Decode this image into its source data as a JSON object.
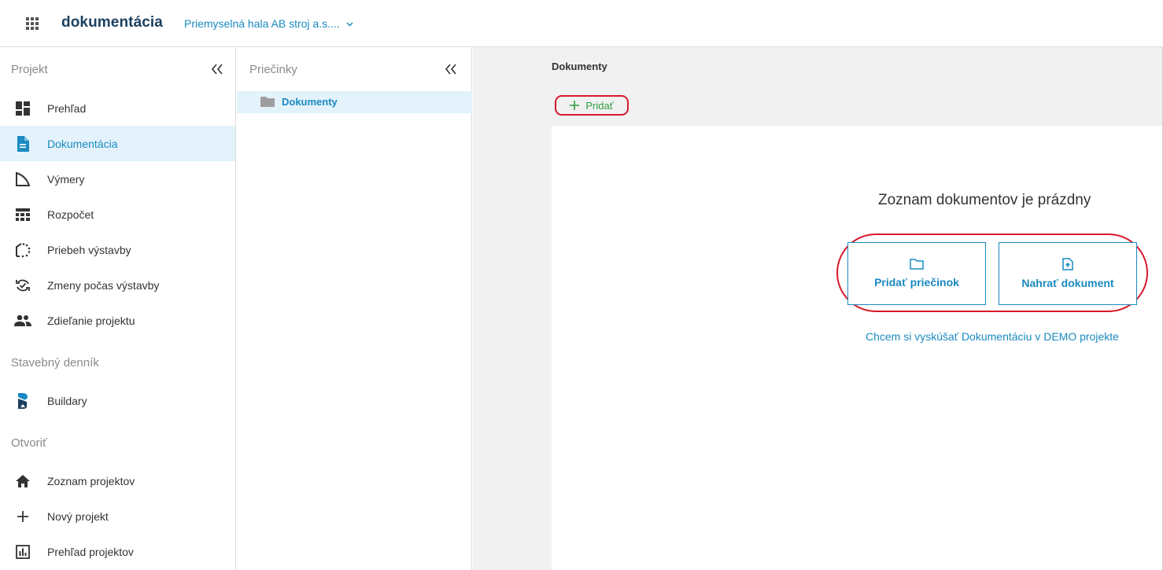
{
  "app": {
    "title": "dokumentácia",
    "project_name": "Priemyselná hala AB stroj a.s...."
  },
  "sidebar": {
    "section_project": "Projekt",
    "section_diary": "Stavebný denník",
    "section_open": "Otvoriť",
    "items": [
      {
        "label": "Prehľad",
        "icon": "dashboard-icon",
        "active": false
      },
      {
        "label": "Dokumentácia",
        "icon": "document-icon",
        "active": true
      },
      {
        "label": "Výmery",
        "icon": "measure-icon",
        "active": false
      },
      {
        "label": "Rozpočet",
        "icon": "budget-icon",
        "active": false
      },
      {
        "label": "Priebeh výstavby",
        "icon": "progress-icon",
        "active": false
      },
      {
        "label": "Zmeny počas výstavby",
        "icon": "changes-icon",
        "active": false
      },
      {
        "label": "Zdieľanie projektu",
        "icon": "people-icon",
        "active": false
      }
    ],
    "diary_items": [
      {
        "label": "Buildary",
        "icon": "buildary-logo-icon"
      }
    ],
    "open_items": [
      {
        "label": "Zoznam projektov",
        "icon": "home-icon"
      },
      {
        "label": "Nový projekt",
        "icon": "plus-icon"
      },
      {
        "label": "Prehľad projektov",
        "icon": "chart-icon"
      }
    ]
  },
  "folders": {
    "title": "Priečinky",
    "items": [
      {
        "label": "Dokumenty",
        "icon": "folder-icon",
        "active": true
      }
    ]
  },
  "main": {
    "title": "Dokumenty",
    "add_label": "Pridať",
    "empty_title": "Zoznam dokumentov je prázdny",
    "add_folder_label": "Pridať priečinok",
    "upload_label": "Nahrať dokument",
    "demo_link": "Chcem si vyskúšať Dokumentáciu v DEMO projekte"
  },
  "colors": {
    "accent": "#1a8ac0",
    "active_bg": "#e3f2fb",
    "add_green": "#2d9d3f",
    "highlight_red": "#d8192b",
    "title_navy": "#1c3f5e"
  }
}
